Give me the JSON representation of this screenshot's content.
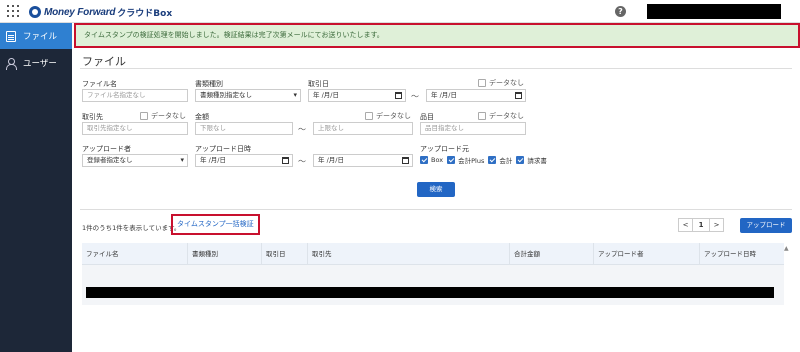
{
  "app": {
    "logo_text": "Money Forward",
    "app_name": "クラウドBox",
    "help": "?"
  },
  "sidebar": {
    "items": [
      {
        "label": "ファイル",
        "icon": "file-icon",
        "active": true
      },
      {
        "label": "ユーザー",
        "icon": "user-icon",
        "active": false
      }
    ]
  },
  "alert": {
    "message": "タイムスタンプの検証処理を開始しました。検証結果は完了次第メールにてお送りいたします。"
  },
  "page": {
    "title": "ファイル"
  },
  "filters": {
    "file_name": {
      "label": "ファイル名",
      "placeholder": "ファイル名指定なし"
    },
    "doc_type": {
      "label": "書類種別",
      "value": "書類種別指定なし"
    },
    "txn_date": {
      "label": "取引日",
      "from": "年 /月/日",
      "to": "年 /月/日",
      "none_label": "データなし"
    },
    "partner": {
      "label": "取引先",
      "placeholder": "取引先指定なし",
      "none_label": "データなし"
    },
    "amount": {
      "label": "金額",
      "min": "下限なし",
      "max": "上限なし",
      "none_label": "データなし"
    },
    "item": {
      "label": "品目",
      "placeholder": "品目指定なし",
      "none_label": "データなし"
    },
    "uploader": {
      "label": "アップロード者",
      "value": "登録者指定なし"
    },
    "upload_date": {
      "label": "アップロード日時",
      "from": "年 /月/日",
      "to": "年 /月/日"
    },
    "source": {
      "label": "アップロード元",
      "options": [
        {
          "label": "Box",
          "checked": true
        },
        {
          "label": "会計Plus",
          "checked": true
        },
        {
          "label": "会計",
          "checked": true
        },
        {
          "label": "請求書",
          "checked": true
        }
      ]
    },
    "tilde": "〜"
  },
  "search_button": "検索",
  "results": {
    "count_text": "1件のうち1件を表示しています。",
    "timestamp_link": "タイムスタンプ一括検証",
    "pager": {
      "prev": "<",
      "current": "1",
      "next": ">"
    },
    "upload_button": "アップロード"
  },
  "table": {
    "columns": [
      "ファイル名",
      "書類種別",
      "取引日",
      "取引先",
      "合計金額",
      "アップロード者",
      "アップロード日時"
    ]
  }
}
